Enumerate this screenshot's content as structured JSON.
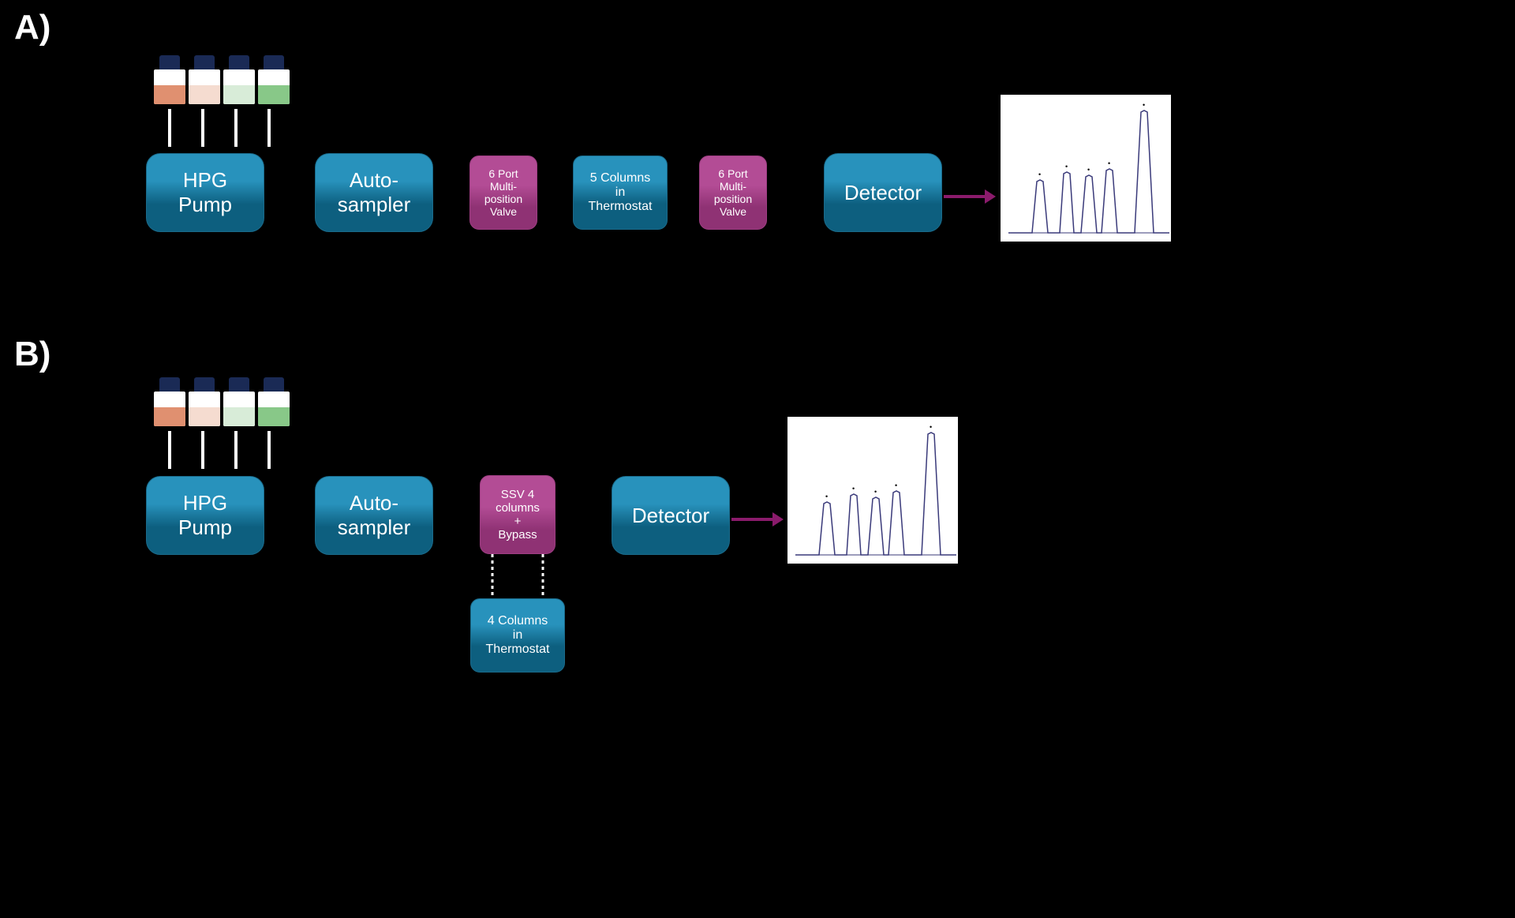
{
  "sectionA": {
    "label": "A)",
    "hpg": "HPG\nPump",
    "autosampler": "Auto-\nsampler",
    "valve1": "6 Port\nMulti-\nposition\nValve",
    "columns": "5 Columns\nin\nThermostat",
    "valve2": "6 Port\nMulti-\nposition\nValve",
    "detector": "Detector"
  },
  "sectionB": {
    "label": "B)",
    "hpg": "HPG\nPump",
    "autosampler": "Auto-\nsampler",
    "ssv": "SSV 4\ncolumns\n+\nBypass",
    "detector": "Detector",
    "columns_below": "4 Columns\nin\nThermostat"
  },
  "bottle_colors": [
    "#e09070",
    "#f5dcd0",
    "#d8ecd8",
    "#88c888"
  ],
  "chromatogram_peaks": [
    {
      "x": 0.22,
      "h": 0.35
    },
    {
      "x": 0.38,
      "h": 0.4
    },
    {
      "x": 0.5,
      "h": 0.38
    },
    {
      "x": 0.62,
      "h": 0.42
    },
    {
      "x": 0.82,
      "h": 0.85
    }
  ]
}
